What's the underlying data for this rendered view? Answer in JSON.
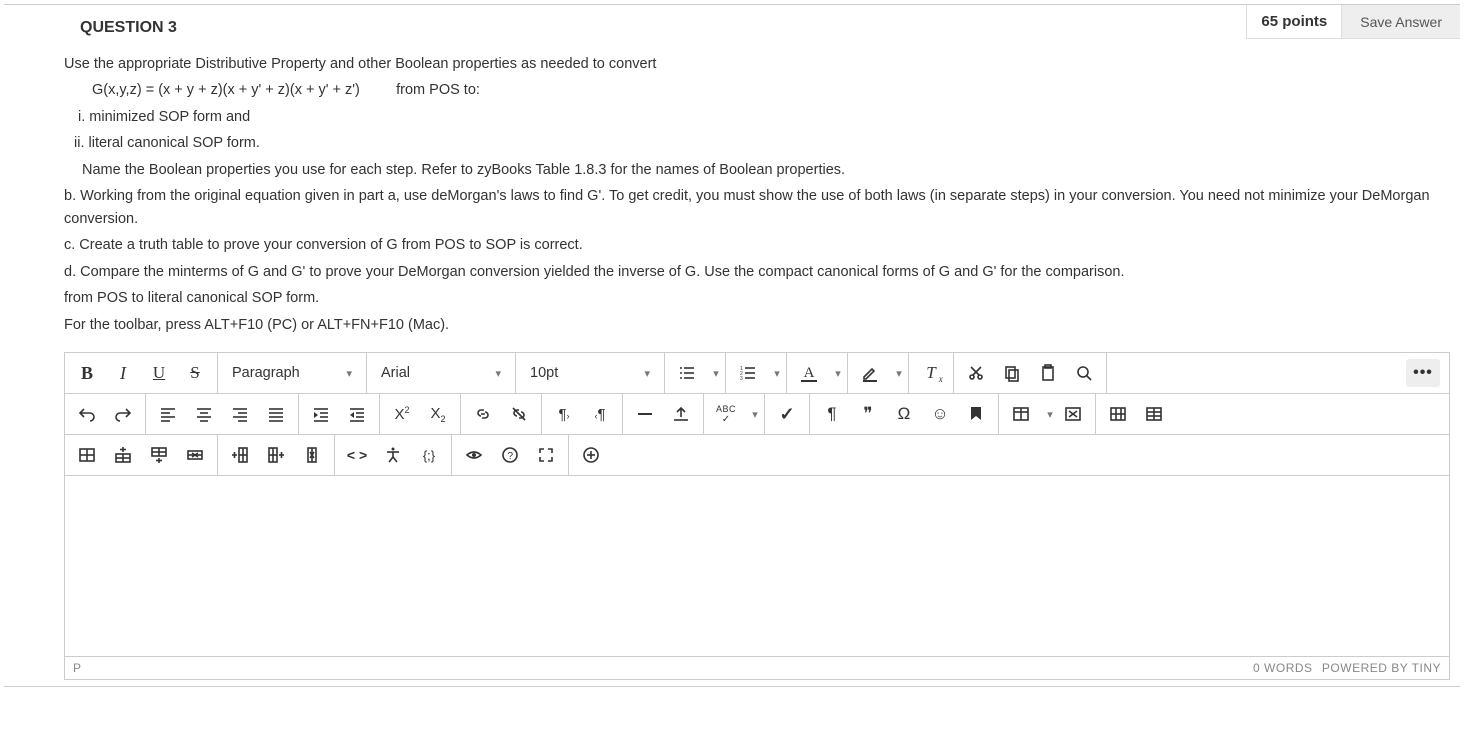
{
  "header": {
    "title": "QUESTION 3",
    "points": "65 points",
    "save_label": "Save Answer"
  },
  "question": {
    "intro": "Use the appropriate Distributive Property and other Boolean properties as needed to convert",
    "equation": "G(x,y,z) = (x + y + z)(x + y' + z)(x + y' + z')         from POS to:",
    "item_i": "i. minimized SOP form and",
    "item_ii": "ii. literal canonical SOP form.",
    "name_props": "Name the Boolean properties you use for each step. Refer to zyBooks Table 1.8.3 for the names of Boolean properties.",
    "part_b": "b. Working from the original equation given in part a, use deMorgan's laws to find G'. To get credit, you must show the use of both laws (in separate steps) in your conversion. You need not minimize your DeMorgan conversion.",
    "part_c": "c. Create a truth table to prove your conversion of G from POS to SOP is correct.",
    "part_d": "d. Compare the minterms of G and G' to prove your DeMorgan conversion yielded the inverse of G. Use the compact canonical forms of G and G' for the comparison.",
    "trailing": "from POS to literal canonical SOP form."
  },
  "toolbar_hint": "For the toolbar, press ALT+F10 (PC) or ALT+FN+F10 (Mac).",
  "toolbar": {
    "block_format": "Paragraph",
    "font_family": "Arial",
    "font_size": "10pt",
    "bold": "B",
    "italic": "I",
    "underline": "U",
    "strike": "S",
    "text_color": "A",
    "clear_fmt": "T",
    "abc": "ABC",
    "check": "✓",
    "pilcrow": "¶",
    "quote": "❞",
    "omega": "Ω",
    "smile": "☺",
    "bookmark_glyph": "▮",
    "code": "< >",
    "braces": "{;}",
    "question": "?",
    "plus": "+",
    "more": "•••"
  },
  "statusbar": {
    "path": "P",
    "words": "0 WORDS",
    "branding": "POWERED BY TINY"
  }
}
